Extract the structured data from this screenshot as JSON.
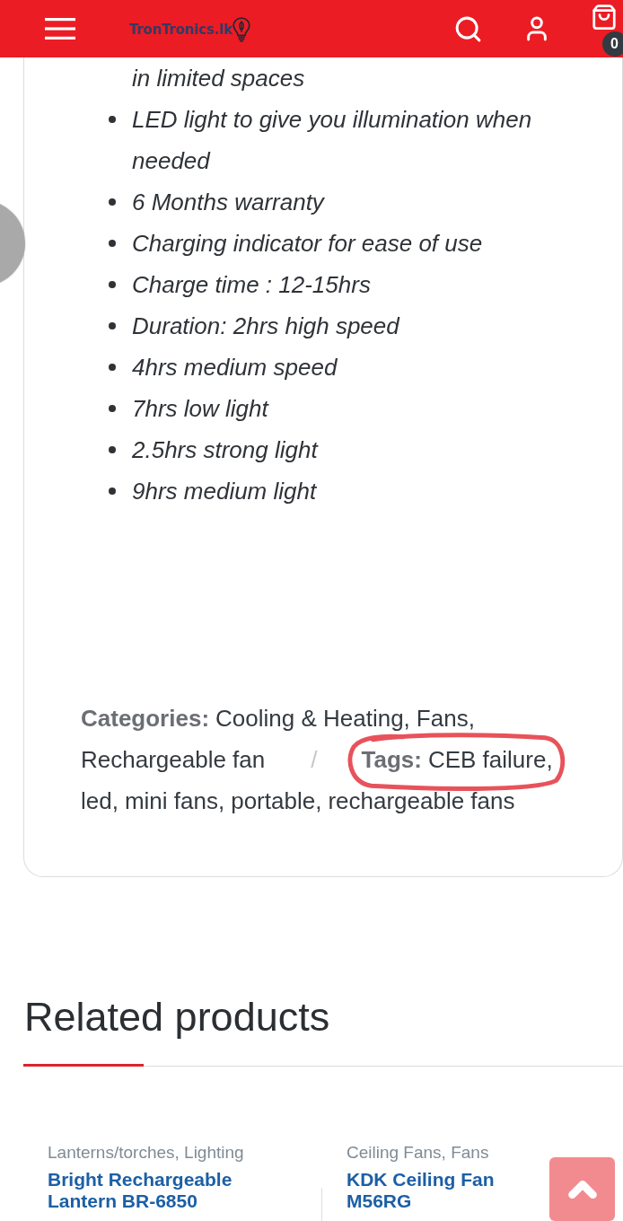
{
  "header": {
    "logo": "TronTronics.lk",
    "cart_count": "0"
  },
  "features": [
    {
      "kind": "continuation",
      "text": "in limited spaces"
    },
    {
      "kind": "bullet",
      "text": "LED light to give you illumination when needed"
    },
    {
      "kind": "bullet",
      "text": "6 Months warranty"
    },
    {
      "kind": "bullet",
      "text": "Charging indicator for ease of use"
    },
    {
      "kind": "bullet",
      "text": "Charge time : 12-15hrs"
    },
    {
      "kind": "bullet",
      "text": "Duration: 2hrs high speed"
    },
    {
      "kind": "bullet",
      "text": "4hrs medium speed"
    },
    {
      "kind": "bullet",
      "text": "7hrs low light"
    },
    {
      "kind": "bullet",
      "text": "2.5hrs strong light"
    },
    {
      "kind": "bullet",
      "text": "9hrs medium light"
    }
  ],
  "meta": {
    "categories_label": "Categories:",
    "categories": [
      "Cooling & Heating,",
      "Fans,",
      "Rechargeable fan"
    ],
    "separator": "/",
    "tags_label": "Tags:",
    "tags": [
      {
        "text": "CEB failure,",
        "circled": true
      },
      {
        "text": "led,",
        "circled": false
      },
      {
        "text": "mini fans,",
        "circled": false
      },
      {
        "text": "portable,",
        "circled": false
      },
      {
        "text": "rechargeable fans",
        "circled": false
      }
    ]
  },
  "related": {
    "title": "Related products",
    "products": [
      {
        "categories": "Lanterns/torches, Lighting",
        "name": "Bright Rechargeable Lantern BR-6850"
      },
      {
        "categories": "Ceiling Fans, Fans",
        "name": "KDK Ceiling Fan M56RG"
      }
    ]
  }
}
